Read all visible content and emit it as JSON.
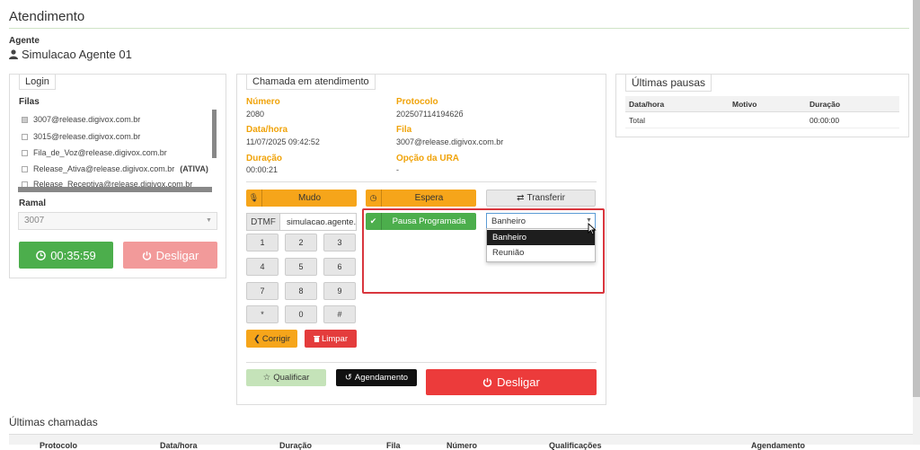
{
  "page": {
    "title": "Atendimento"
  },
  "agent": {
    "label": "Agente",
    "name": "Simulacao Agente 01"
  },
  "login": {
    "legend": "Login",
    "filas_label": "Filas",
    "queues": [
      {
        "name": "3007@release.digivox.com.br",
        "extra": "",
        "checked": true
      },
      {
        "name": "3015@release.digivox.com.br",
        "extra": "",
        "checked": false
      },
      {
        "name": "Fila_de_Voz@release.digivox.com.br",
        "extra": "",
        "checked": false
      },
      {
        "name": "Release_Ativa@release.digivox.com.br",
        "extra": "(ATIVA)",
        "checked": false
      },
      {
        "name": "Release_Receptiva@release.digivox.com.br",
        "extra": "",
        "checked": false
      }
    ],
    "ramal_label": "Ramal",
    "ramal_value": "3007",
    "timer": "00:35:59",
    "hangup_label": "Desligar"
  },
  "call": {
    "legend": "Chamada em atendimento",
    "numero_label": "Número",
    "numero": "2080",
    "protocolo_label": "Protocolo",
    "protocolo": "20250711419462б",
    "datahora_label": "Data/hora",
    "datahora": "11/07/2025 09:42:52",
    "fila_label": "Fila",
    "fila": "3007@release.digivox.com.br",
    "duracao_label": "Duração",
    "duracao": "00:00:21",
    "ura_label": "Opção da URA",
    "ura": "-",
    "mudo_label": "Mudo",
    "espera_label": "Espera",
    "transferir_label": "Transferir",
    "dtmf_label": "DTMF",
    "dtmf_value": "simulacao.agente.",
    "keys": [
      "1",
      "2",
      "3",
      "4",
      "5",
      "6",
      "7",
      "8",
      "9",
      "*",
      "0",
      "#"
    ],
    "corrigir_label": "Corrigir",
    "limpar_label": "Limpar",
    "pausa_label": "Pausa Programada",
    "pausa_selected": "Banheiro",
    "pausa_options": [
      "Banheiro",
      "Reunião"
    ],
    "qualificar_label": "Qualificar",
    "agendamento_label": "Agendamento",
    "desligar_label": "Desligar"
  },
  "pausas": {
    "legend": "Últimas pausas",
    "headers": [
      "Data/hora",
      "Motivo",
      "Duração"
    ],
    "total_label": "Total",
    "total_value": "00:00:00"
  },
  "chamadas": {
    "title": "Últimas chamadas",
    "headers": [
      "Protocolo",
      "Data/hora",
      "Duração",
      "Fila",
      "Número",
      "Qualificações",
      "Agendamento"
    ]
  },
  "colors": {
    "accent_orange": "#f6a51a",
    "success_green": "#4cae4c",
    "danger_red": "#ec3b3b",
    "highlight": "#d9363e"
  }
}
